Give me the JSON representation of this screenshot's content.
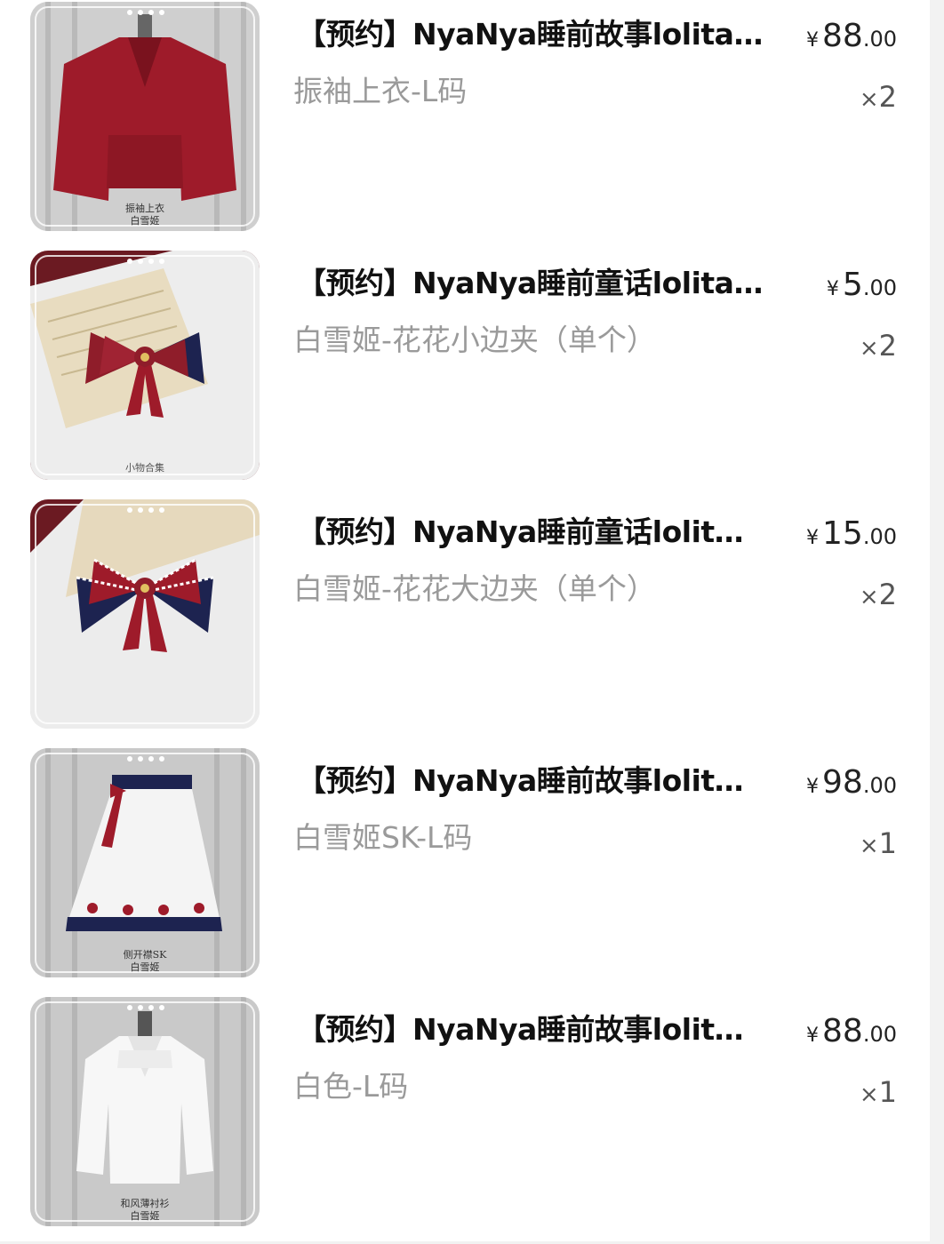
{
  "cart": {
    "items": [
      {
        "title": "【预约】NyaNya睡前故事lolita…",
        "variant": "振袖上衣-L码",
        "currency": "¥",
        "price_int": "88",
        "price_dec": ".00",
        "qty_x": "×",
        "qty": "2",
        "image": "red-kimono-jacket-photo",
        "image_caption": [
          "振袖上衣",
          "白雪姬"
        ]
      },
      {
        "title": "【预约】NyaNya睡前童话lolita…",
        "variant": "白雪姬-花花小边夹（单个）",
        "currency": "¥",
        "price_int": "5",
        "price_dec": ".00",
        "qty_x": "×",
        "qty": "2",
        "image": "small-bow-hairclip-photo",
        "image_caption": [
          "小物合集"
        ]
      },
      {
        "title": "【预约】NyaNya睡前童话lolit…",
        "variant": "白雪姬-花花大边夹（单个）",
        "currency": "¥",
        "price_int": "15",
        "price_dec": ".00",
        "qty_x": "×",
        "qty": "2",
        "image": "large-bow-hairclip-photo",
        "image_caption": []
      },
      {
        "title": "【预约】NyaNya睡前故事lolit…",
        "variant": "白雪姬SK-L码",
        "currency": "¥",
        "price_int": "98",
        "price_dec": ".00",
        "qty_x": "×",
        "qty": "1",
        "image": "white-skirt-photo",
        "image_caption": [
          "侧开襟SK",
          "白雪姬"
        ]
      },
      {
        "title": "【预约】NyaNya睡前故事lolit…",
        "variant": "白色-L码",
        "currency": "¥",
        "price_int": "88",
        "price_dec": ".00",
        "qty_x": "×",
        "qty": "1",
        "image": "white-blouse-photo",
        "image_caption": [
          "和风薄衬衫",
          "白雪姬"
        ]
      }
    ]
  },
  "colors": {
    "page_bg": "#ffffff",
    "title_text": "#111111",
    "variant_text": "#9a9a9a",
    "price_text": "#222222",
    "qty_text": "#555555",
    "product_red": "#9e1b2a",
    "product_navy": "#1d2350",
    "photo_bg": "#c9c9c9"
  }
}
